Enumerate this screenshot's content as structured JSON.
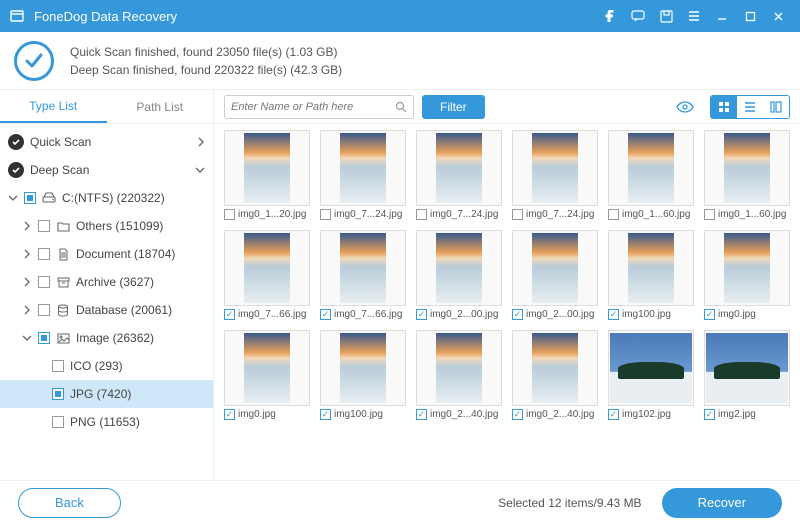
{
  "app": {
    "title": "FoneDog Data Recovery"
  },
  "status": {
    "quick": "Quick Scan finished, found 23050 file(s) (1.03 GB)",
    "deep": "Deep Scan finished, found 220322 file(s) (42.3 GB)"
  },
  "sidebar": {
    "tabs": {
      "type": "Type List",
      "path": "Path List"
    },
    "summary": {
      "quick": "Quick Scan",
      "deep": "Deep Scan"
    },
    "drive": "C:(NTFS) (220322)",
    "cats": {
      "others": "Others (151099)",
      "document": "Document (18704)",
      "archive": "Archive (3627)",
      "database": "Database (20061)",
      "image": "Image (26362)",
      "ico": "ICO (293)",
      "jpg": "JPG (7420)",
      "png": "PNG (11653)"
    }
  },
  "toolbar": {
    "search_placeholder": "Enter Name or Path here",
    "filter": "Filter"
  },
  "grid": [
    [
      {
        "fn": "img0_1...20.jpg",
        "chk": false,
        "kind": "sky"
      },
      {
        "fn": "img0_7...24.jpg",
        "chk": false,
        "kind": "sky"
      },
      {
        "fn": "img0_7...24.jpg",
        "chk": false,
        "kind": "sky"
      },
      {
        "fn": "img0_7...24.jpg",
        "chk": false,
        "kind": "sky"
      },
      {
        "fn": "img0_1...60.jpg",
        "chk": false,
        "kind": "sky"
      },
      {
        "fn": "img0_1...60.jpg",
        "chk": false,
        "kind": "sky"
      }
    ],
    [
      {
        "fn": "img0_7...66.jpg",
        "chk": true,
        "kind": "sky"
      },
      {
        "fn": "img0_7...66.jpg",
        "chk": true,
        "kind": "sky"
      },
      {
        "fn": "img0_2...00.jpg",
        "chk": true,
        "kind": "sky"
      },
      {
        "fn": "img0_2...00.jpg",
        "chk": true,
        "kind": "sky"
      },
      {
        "fn": "img100.jpg",
        "chk": true,
        "kind": "sky"
      },
      {
        "fn": "img0.jpg",
        "chk": true,
        "kind": "sky"
      }
    ],
    [
      {
        "fn": "img0.jpg",
        "chk": true,
        "kind": "sky"
      },
      {
        "fn": "img100.jpg",
        "chk": true,
        "kind": "sky"
      },
      {
        "fn": "img0_2...40.jpg",
        "chk": true,
        "kind": "sky"
      },
      {
        "fn": "img0_2...40.jpg",
        "chk": true,
        "kind": "sky"
      },
      {
        "fn": "img102.jpg",
        "chk": true,
        "kind": "island"
      },
      {
        "fn": "img2.jpg",
        "chk": true,
        "kind": "island"
      }
    ]
  ],
  "footer": {
    "back": "Back",
    "selected": "Selected 12 items/9.43 MB",
    "recover": "Recover"
  }
}
